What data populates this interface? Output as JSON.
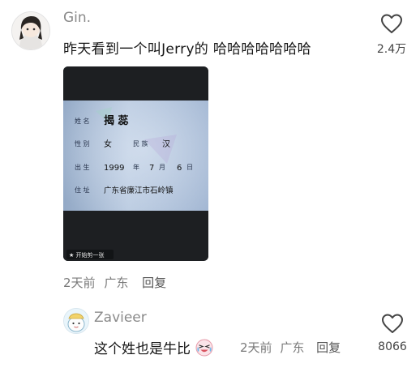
{
  "comment": {
    "username": "Gin.",
    "text": "昨天看到一个叫Jerry的 哈哈哈哈哈哈哈",
    "like_count": "2.4万",
    "time": "2天前",
    "location": "广东",
    "reply_label": "回复",
    "photo": {
      "name_label": "姓 名",
      "name_value": "揭 蕊",
      "sex_label": "性 别",
      "sex_value": "女",
      "ethnicity_label": "民 族",
      "ethnicity_value": "汉",
      "birth_label": "出 生",
      "birth_year": "1999",
      "year_unit": "年",
      "birth_month": "7",
      "month_unit": "月",
      "birth_day": "6",
      "day_unit": "日",
      "address_label": "住 址",
      "address_value": "广东省廉江市石岭镇",
      "watermark": "★ 开始剪一张"
    }
  },
  "reply": {
    "username": "Zavieer",
    "text": "这个姓也是牛比",
    "emoji": "crying-laughing-emoji",
    "time": "2天前",
    "location": "广东",
    "reply_label": "回复",
    "like_count": "8066"
  }
}
